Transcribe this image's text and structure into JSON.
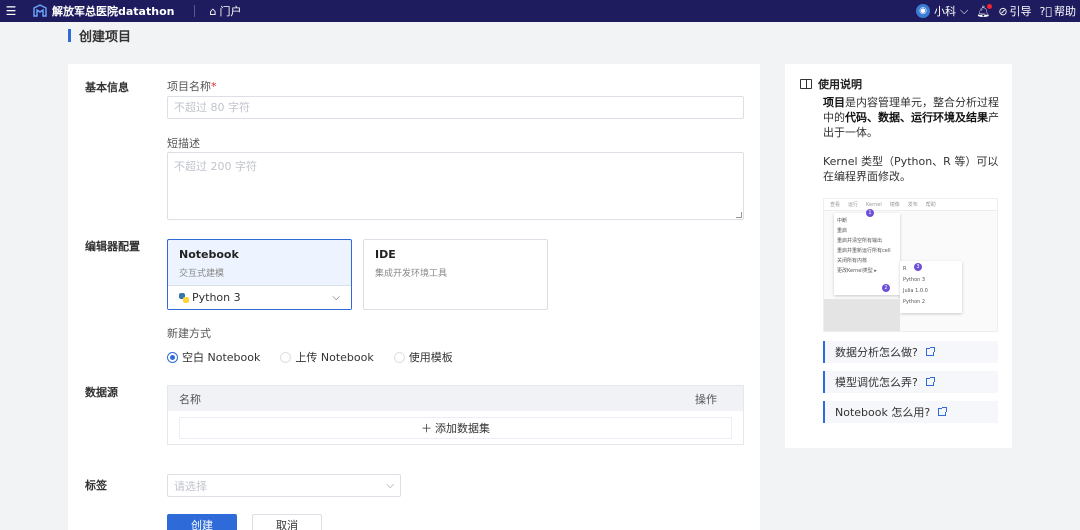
{
  "topbar": {
    "app_title": "解放军总医院datathon",
    "portal_label": "门户",
    "user_name": "小科",
    "guide_label": "引导",
    "help_label": "帮助",
    "menu_icon": "hamburger-icon",
    "portal_icon": "home-icon"
  },
  "page": {
    "title": "创建项目"
  },
  "form": {
    "basic_info_label": "基本信息",
    "project_name_label": "项目名称",
    "project_name_required": "*",
    "project_name_placeholder": "不超过 80 字符",
    "short_desc_label": "短描述",
    "short_desc_placeholder": "不超过 200 字符",
    "editor_config_label": "编辑器配置",
    "editors": [
      {
        "title": "Notebook",
        "desc": "交互式建模",
        "kernel": "Python 3",
        "selected": true
      },
      {
        "title": "IDE",
        "desc": "集成开发环境工具",
        "selected": false
      }
    ],
    "create_method_label": "新建方式",
    "create_methods": [
      {
        "label": "空白 Notebook",
        "checked": true
      },
      {
        "label": "上传 Notebook",
        "checked": false
      },
      {
        "label": "使用模板",
        "checked": false
      }
    ],
    "datasource_label": "数据源",
    "datasource_table": {
      "col_name": "名称",
      "col_action": "操作",
      "add_label": "添加数据集"
    },
    "tags_label": "标签",
    "tags_placeholder": "请选择",
    "create_button": "创建",
    "cancel_button": "取消"
  },
  "help": {
    "title": "使用说明",
    "para1_prefix": "项目",
    "para1_mid": "是内容管理单元，整合分析过程中的",
    "para1_bold": "代码、数据、运行环境及结果",
    "para1_suffix": "产出于一体。",
    "para2": "Kernel 类型（Python、R 等）可以在编程界面修改。",
    "links": [
      {
        "label": "数据分析怎么做?"
      },
      {
        "label": "模型调优怎么弄?"
      },
      {
        "label": "Notebook 怎么用?"
      }
    ]
  },
  "colors": {
    "topbar_bg": "#1e1c5e",
    "accent": "#2f6bd8",
    "page_bg": "#f2f3f5"
  }
}
